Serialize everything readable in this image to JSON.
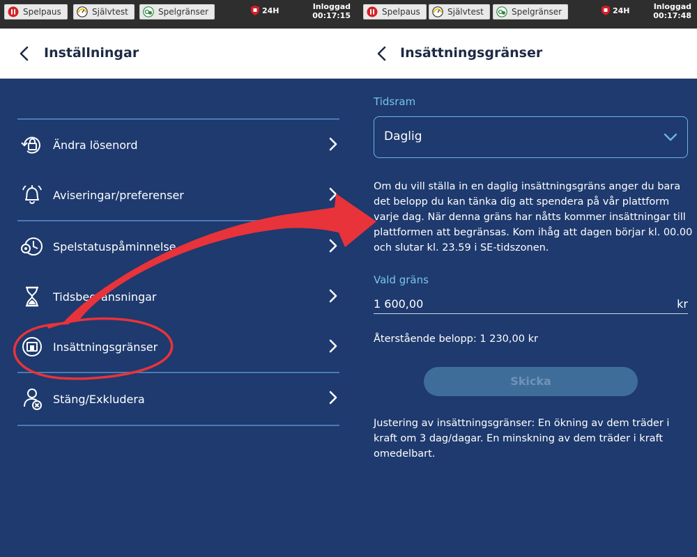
{
  "topbar": {
    "spelpaus": "Spelpaus",
    "sjalvtest": "Självtest",
    "spelgranser": "Spelgränser",
    "limit_24h": "24H",
    "login_label": "Inloggad",
    "left_time": "00:17:15",
    "right_time": "00:17:48"
  },
  "settings": {
    "title": "Inställningar",
    "items": [
      {
        "label": "Ändra lösenord",
        "icon": "password-lock-icon"
      },
      {
        "label": "Aviseringar/preferenser",
        "icon": "bell-icon"
      },
      {
        "label": "Spelstatuspåminnelse",
        "icon": "clock-reminder-icon"
      },
      {
        "label": "Tidsbegränsningar",
        "icon": "hourglass-icon"
      },
      {
        "label": "Insättningsgränser",
        "icon": "deposit-limit-icon"
      },
      {
        "label": "Stäng/Exkludera",
        "icon": "exclude-user-icon"
      }
    ]
  },
  "deposit": {
    "title": "Insättningsgränser",
    "timeframe_label": "Tidsram",
    "timeframe_value": "Daglig",
    "description": "Om du vill ställa in en daglig insättningsgräns anger du bara det belopp du kan tänka dig att spendera på vår plattform varje dag. När denna gräns har nåtts kommer insättningar till plattformen att begränsas. Kom ihåg att dagen börjar kl. 00.00 och slutar kl. 23.59 i SE-tidszonen.",
    "limit_label": "Vald gräns",
    "limit_value": "1 600,00",
    "limit_unit": "kr",
    "remaining": "Återstående belopp: 1 230,00 kr",
    "submit_label": "Skicka",
    "adjust_note": "Justering av insättningsgränser: En ökning av dem träder i kraft om 3 dag/dagar. En minskning av dem träder i kraft omedelbart."
  },
  "colors": {
    "background": "#1e3a6e",
    "accent": "#7cc3e8",
    "annotation": "#e8333a"
  }
}
